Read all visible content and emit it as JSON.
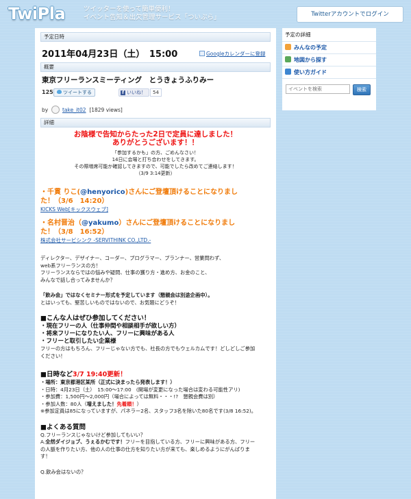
{
  "header": {
    "logo": "TwiPla",
    "tagline_1": "ツイッターを使って簡単便利！",
    "tagline_2": "イベント告知＆出欠管理サービス「ついぷら」",
    "login_label": "Twitterアカウントでログイン"
  },
  "event": {
    "schedule_label": "予定日時",
    "date": "2011年04月23日（土）　15:00",
    "gcal_label": "Googleカレンダーに登録",
    "overview_label": "概要",
    "title": "東京フリーランスミーティング　とうきょうふりみー",
    "tweet_count": "125",
    "tweet_label": "ツイートする",
    "like_label": "いいね！",
    "like_count": "54",
    "by_label": "by",
    "organizer": "take_it02",
    "views": "[1829 views]",
    "details_label": "詳細"
  },
  "details": {
    "red_1": "お陰様で告知からたった2日で定員に達しました！",
    "red_2": "ありがとうございます！！",
    "note_1": "「参加するかも」の方、ごめんなさい！",
    "note_2": "14日に会場と打ち合わせをしてきます。",
    "note_3": "その際増席可能か確認してきますので、可能でしたら改めてご連絡します！",
    "note_4": "（3/9 3:14更新）",
    "sp1_a": "・千貫 りこ(",
    "sp1_handle": "@henyorico",
    "sp1_b": ")さんにご登壇頂けることになりまし",
    "sp1_c": "た！（3/6　14:20）",
    "sp1_link": "KICKS Web[キックスウェブ]",
    "sp2_a": "・名村晋治（",
    "sp2_handle": "@yakumo",
    "sp2_b": "）さんにご登壇頂けることになりまし",
    "sp2_c": "た！（3/8　16:52）",
    "sp2_link": "株式会社サービシンク -SERVITHINK CO.,LTD.-",
    "intro_1": "ディレクター、デザイナー、コーダー、プログラマー、プランナー、営業問わず、",
    "intro_2": "web系フリーランスの方！",
    "intro_3": "フリーランスならではの悩みや疑問、仕事の獲り方・進め方、お金のこと、",
    "intro_4": "みんなで話し合ってみませんか？",
    "seminar_1": "「飲み会」ではなくセミナー形式を予定しています（懇親会は別途企画中）。",
    "seminar_2": "とはいっても、堅苦しいものではないので、お気軽にどうぞ！",
    "target_head": "■こんな人はぜひ参加してください！",
    "target_1": "・現在フリーの人（仕事仲間や相談相手が欲しい方）",
    "target_2": "・将来フリーになりたい人、フリーに興味がある人",
    "target_3": "・フリーと取引したい企業様",
    "welcome_1": "フリーの方はもちろん、フリーじゃない方でも、社長の方でもウェルカムです！どしどしご参加",
    "welcome_2": "ください！",
    "when_head_a": "■日時など",
    "when_head_b": "3/7 19:40更新！",
    "when_1": "・場所：東京都港区某所（正式に決まったら発表します！）",
    "when_2": "・日時：4月23日（土）　15:00〜17:00　(開場が変更になった場合は変わる可能性アリ)",
    "when_3": "・参加費：1,500円〜2,000円（場合によっては無料・・・!?　懇親会費は別）",
    "when_4a": "・参加人数：80人（",
    "when_4b": "増えました！",
    "when_4c": "先着順！",
    "when_4d": "）",
    "when_5": "※参加定員は85になっていますが、パネラー2名、スタッフ3名を除いた80名です(3/8 16:52)。",
    "faq_head": "■よくある質問",
    "faq_q1": "Q.フリーランスじゃないけど参加してもいい？",
    "faq_a1a": "A.",
    "faq_a1b": "全然ダイジョブ、うぇるかむです！",
    "faq_a1c": "フリーを目指している方、フリーに興味がある方、フリー",
    "faq_a1d": "の人脈を作りたい方、他の人の仕事の仕方を知りたい方が来ても、楽しめるようにがんばりま",
    "faq_a1e": "す！",
    "faq_q2": "Q.飲み会はないの？"
  },
  "sidebar": {
    "head": "予定の詳細",
    "items": [
      {
        "label": "みんなの予定",
        "color": "#f2a23a"
      },
      {
        "label": "地図から探す",
        "color": "#5aa85a"
      },
      {
        "label": "使い方ガイド",
        "color": "#3d86d1"
      }
    ],
    "search_placeholder": "イベントを検索",
    "search_button": "検索"
  }
}
